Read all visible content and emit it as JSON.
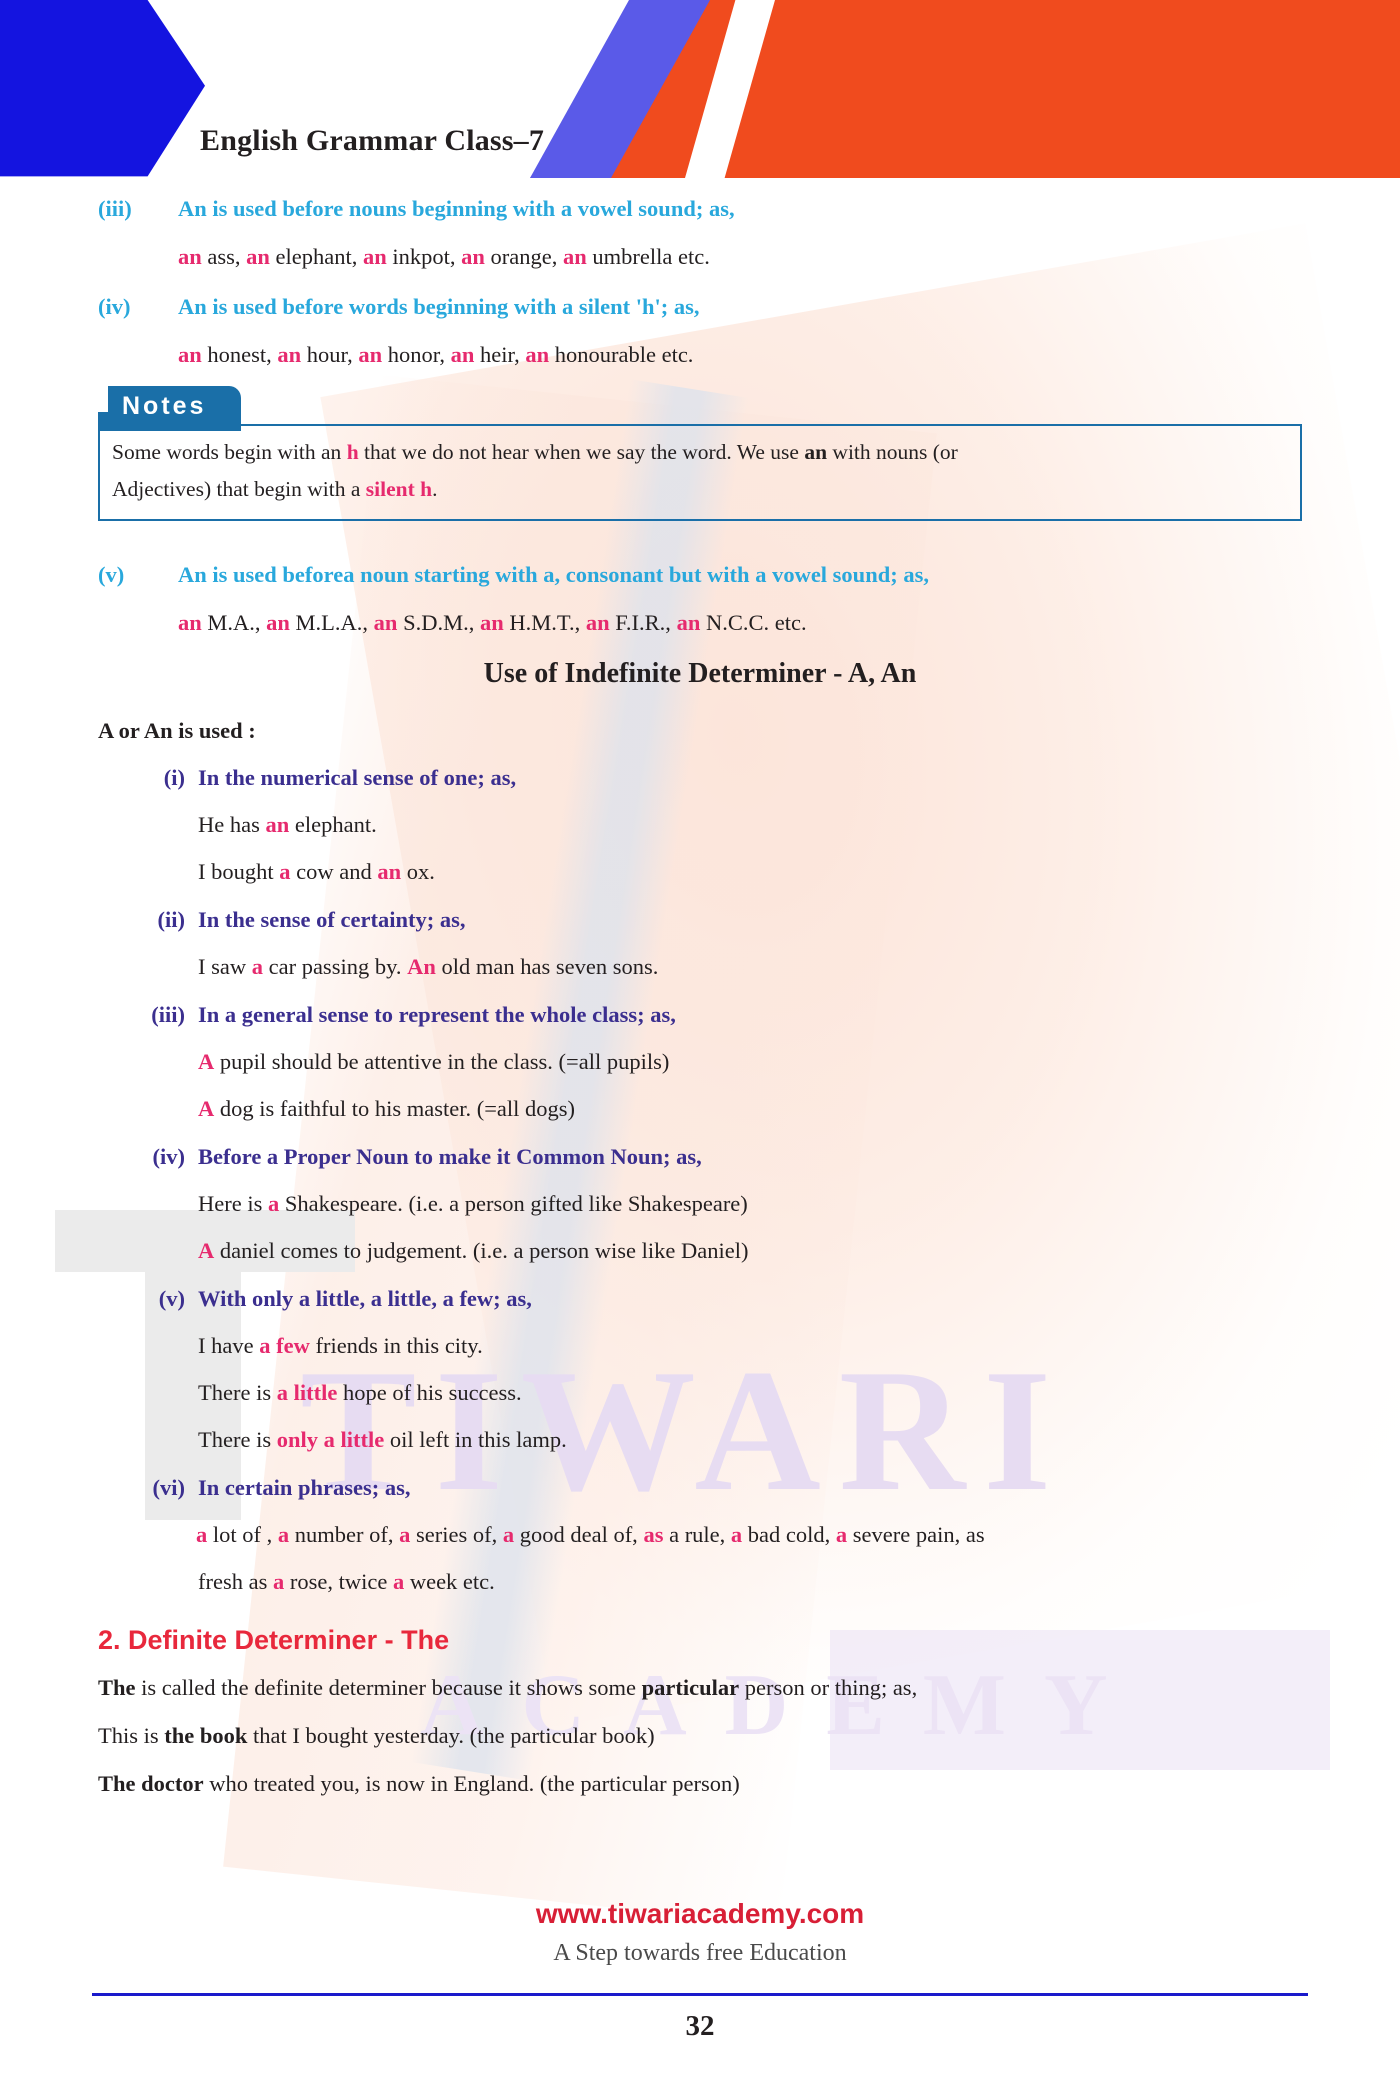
{
  "header": {
    "title": "English Grammar Class–7"
  },
  "top_rules": [
    {
      "marker": "(iii)",
      "heading": "An is used before nouns beginning with a vowel sound; as,",
      "example_parts": [
        {
          "t": "an",
          "hl": true
        },
        {
          "t": " ass, ",
          "hl": false
        },
        {
          "t": "an",
          "hl": true
        },
        {
          "t": " elephant, ",
          "hl": false
        },
        {
          "t": "an",
          "hl": true
        },
        {
          "t": " inkpot, ",
          "hl": false
        },
        {
          "t": "an",
          "hl": true
        },
        {
          "t": " orange, ",
          "hl": false
        },
        {
          "t": "an",
          "hl": true
        },
        {
          "t": " umbrella etc.",
          "hl": false
        }
      ]
    },
    {
      "marker": "(iv)",
      "heading": "An is used before words beginning with a silent 'h'; as,",
      "example_parts": [
        {
          "t": "an",
          "hl": true
        },
        {
          "t": " honest, ",
          "hl": false
        },
        {
          "t": "an",
          "hl": true
        },
        {
          "t": " hour, ",
          "hl": false
        },
        {
          "t": "an",
          "hl": true
        },
        {
          "t": " honor, ",
          "hl": false
        },
        {
          "t": "an",
          "hl": true
        },
        {
          "t": " heir, ",
          "hl": false
        },
        {
          "t": "an",
          "hl": true
        },
        {
          "t": " honourable etc.",
          "hl": false
        }
      ]
    }
  ],
  "notes": {
    "label": "Notes",
    "line1_parts": [
      {
        "t": "Some words begin with an ",
        "style": "plain"
      },
      {
        "t": "h",
        "style": "hl"
      },
      {
        "t": " that we do not hear when we say the word. We use ",
        "style": "plain"
      },
      {
        "t": "an",
        "style": "bold"
      },
      {
        "t": " with nouns (or",
        "style": "plain"
      }
    ],
    "line2_parts": [
      {
        "t": "Adjectives) that begin with a ",
        "style": "plain"
      },
      {
        "t": "silent h",
        "style": "hl"
      },
      {
        "t": ".",
        "style": "plain"
      }
    ]
  },
  "rule_v": {
    "marker": "(v)",
    "heading": "An is used beforea noun starting with a, consonant but with a vowel sound; as,",
    "example_parts": [
      {
        "t": "an",
        "hl": true
      },
      {
        "t": " M.A., ",
        "hl": false
      },
      {
        "t": "an",
        "hl": true
      },
      {
        "t": " M.L.A., ",
        "hl": false
      },
      {
        "t": "an",
        "hl": true
      },
      {
        "t": " S.D.M., ",
        "hl": false
      },
      {
        "t": "an",
        "hl": true
      },
      {
        "t": " H.M.T., ",
        "hl": false
      },
      {
        "t": "an",
        "hl": true
      },
      {
        "t": " F.I.R., ",
        "hl": false
      },
      {
        "t": "an",
        "hl": true
      },
      {
        "t": " N.C.C. etc.",
        "hl": false
      }
    ]
  },
  "section_heading": "Use of Indefinite Determiner - A, An",
  "sub_heading": "A or An is used :",
  "usage_items": [
    {
      "marker": "(i)",
      "heading": "In the numerical sense of one; as,",
      "examples": [
        [
          {
            "t": "He has ",
            "hl": false
          },
          {
            "t": "an",
            "hl": true
          },
          {
            "t": " elephant.",
            "hl": false
          }
        ],
        [
          {
            "t": "I bought ",
            "hl": false
          },
          {
            "t": "a",
            "hl": true
          },
          {
            "t": " cow and ",
            "hl": false
          },
          {
            "t": "an",
            "hl": true
          },
          {
            "t": " ox.",
            "hl": false
          }
        ]
      ]
    },
    {
      "marker": "(ii)",
      "heading": "In the sense of certainty; as,",
      "examples": [
        [
          {
            "t": "I saw ",
            "hl": false
          },
          {
            "t": "a",
            "hl": true
          },
          {
            "t": " car passing by.  ",
            "hl": false
          },
          {
            "t": "An",
            "hl": true
          },
          {
            "t": " old man has seven sons.",
            "hl": false
          }
        ]
      ]
    },
    {
      "marker": "(iii)",
      "heading": "In a general sense to represent the whole class; as,",
      "examples": [
        [
          {
            "t": "A",
            "hl": true
          },
          {
            "t": " pupil should be attentive in the class. (=all pupils)",
            "hl": false
          }
        ],
        [
          {
            "t": "A",
            "hl": true
          },
          {
            "t": " dog is faithful to his master. (=all dogs)",
            "hl": false
          }
        ]
      ]
    },
    {
      "marker": "(iv)",
      "heading": "Before a Proper Noun to make it Common Noun; as,",
      "examples": [
        [
          {
            "t": "Here is ",
            "hl": false
          },
          {
            "t": "a",
            "hl": true
          },
          {
            "t": " Shakespeare. (i.e. a person gifted like Shakespeare)",
            "hl": false
          }
        ],
        [
          {
            "t": "A",
            "hl": true
          },
          {
            "t": " daniel comes to judgement. (i.e. a person wise like Daniel)",
            "hl": false
          }
        ]
      ]
    },
    {
      "marker": "(v)",
      "heading": "With only a little, a little, a few; as,",
      "examples": [
        [
          {
            "t": "I have ",
            "hl": false
          },
          {
            "t": "a few",
            "hl": true
          },
          {
            "t": " friends in this city.",
            "hl": false
          }
        ],
        [
          {
            "t": "There is ",
            "hl": false
          },
          {
            "t": "a little",
            "hl": true
          },
          {
            "t": " hope of his success.",
            "hl": false
          }
        ],
        [
          {
            "t": "There is ",
            "hl": false
          },
          {
            "t": "only a little",
            "hl": true
          },
          {
            "t": " oil left in this lamp.",
            "hl": false
          }
        ]
      ]
    },
    {
      "marker": "(vi)",
      "heading": "In certain phrases; as,",
      "examples": [
        [
          {
            "t": "a",
            "hl": true
          },
          {
            "t": " lot of , ",
            "hl": false
          },
          {
            "t": "a",
            "hl": true
          },
          {
            "t": " number of, ",
            "hl": false
          },
          {
            "t": "a",
            "hl": true
          },
          {
            "t": " series of, ",
            "hl": false
          },
          {
            "t": "a",
            "hl": true
          },
          {
            "t": " good deal of, ",
            "hl": false
          },
          {
            "t": "as",
            "hl": true
          },
          {
            "t": " a rule, ",
            "hl": false
          },
          {
            "t": "a",
            "hl": true
          },
          {
            "t": " bad cold, ",
            "hl": false
          },
          {
            "t": "a",
            "hl": true
          },
          {
            "t": " severe pain, as",
            "hl": false
          }
        ],
        [
          {
            "t": "fresh as ",
            "hl": false
          },
          {
            "t": "a",
            "hl": true
          },
          {
            "t": " rose, twice ",
            "hl": false
          },
          {
            "t": "a",
            "hl": true
          },
          {
            "t": " week etc.",
            "hl": false
          }
        ]
      ]
    }
  ],
  "definite": {
    "heading": "2.  Definite Determiner - The",
    "lines": [
      [
        {
          "t": "The",
          "style": "bold"
        },
        {
          "t": " is called the definite determiner because it shows some ",
          "style": "plain"
        },
        {
          "t": "particular",
          "style": "bold"
        },
        {
          "t": " person or thing; as,",
          "style": "plain"
        }
      ],
      [
        {
          "t": "This is ",
          "style": "plain"
        },
        {
          "t": "the book",
          "style": "bold"
        },
        {
          "t": " that I bought yesterday. (the particular book)",
          "style": "plain"
        }
      ],
      [
        {
          "t": "The doctor",
          "style": "bold"
        },
        {
          "t": " who treated you, is now in England. (the particular person)",
          "style": "plain"
        }
      ]
    ]
  },
  "watermark": {
    "brand": "TIWARI",
    "sub": "ACADEMY"
  },
  "footer": {
    "url": "www.tiwariacademy.com",
    "tagline": "A Step towards free Education",
    "page_number": "32"
  },
  "colors": {
    "cyan": "#29a8dc",
    "purple": "#3b2f8f",
    "pink": "#e62a6e",
    "red": "#e8283c",
    "blue": "#1414e0",
    "orange": "#f04b1e",
    "notes_blue": "#1a6fa8"
  }
}
